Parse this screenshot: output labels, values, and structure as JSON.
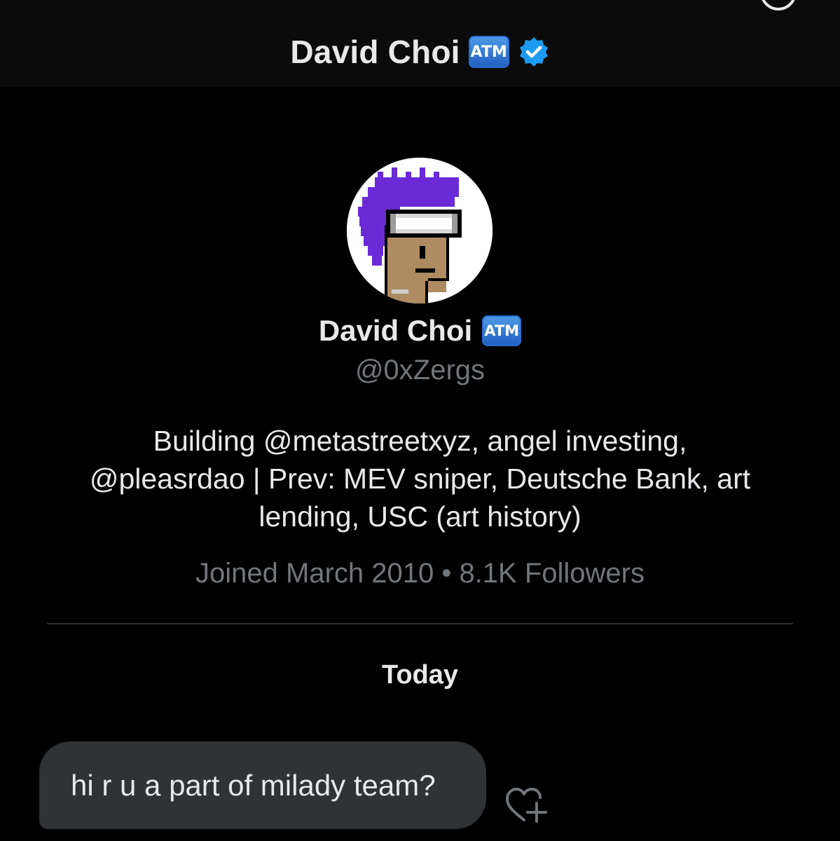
{
  "header": {
    "title": "David Choi",
    "emoji": "ATM",
    "verified": true,
    "icons": [
      "back-arrow-icon",
      "info-icon",
      "verified-badge-icon"
    ],
    "colors": {
      "background": "#0b0b0b",
      "verified": "#1d9bf0"
    }
  },
  "profile": {
    "name": "David Choi",
    "emoji": "ATM",
    "handle": "@0xZergs",
    "bio_lines": [
      "Building @metastreetxyz, angel investing,",
      "@pleasrdao | Prev: MEV sniper, Deutsche Bank, art",
      "lending, USC (art history)"
    ],
    "meta": "Joined March 2010 • 8.1K Followers"
  },
  "conversation": {
    "date_label": "Today",
    "messages": [
      {
        "text": "hi r u a part of milady team?",
        "direction": "incoming"
      }
    ],
    "icons": [
      "add-reaction-icon"
    ]
  },
  "colors": {
    "page_background": "#000000",
    "primary_text": "#e7e9ea",
    "secondary_text": "#71767b",
    "bubble": "#2f3336",
    "divider": "#2f3336"
  }
}
